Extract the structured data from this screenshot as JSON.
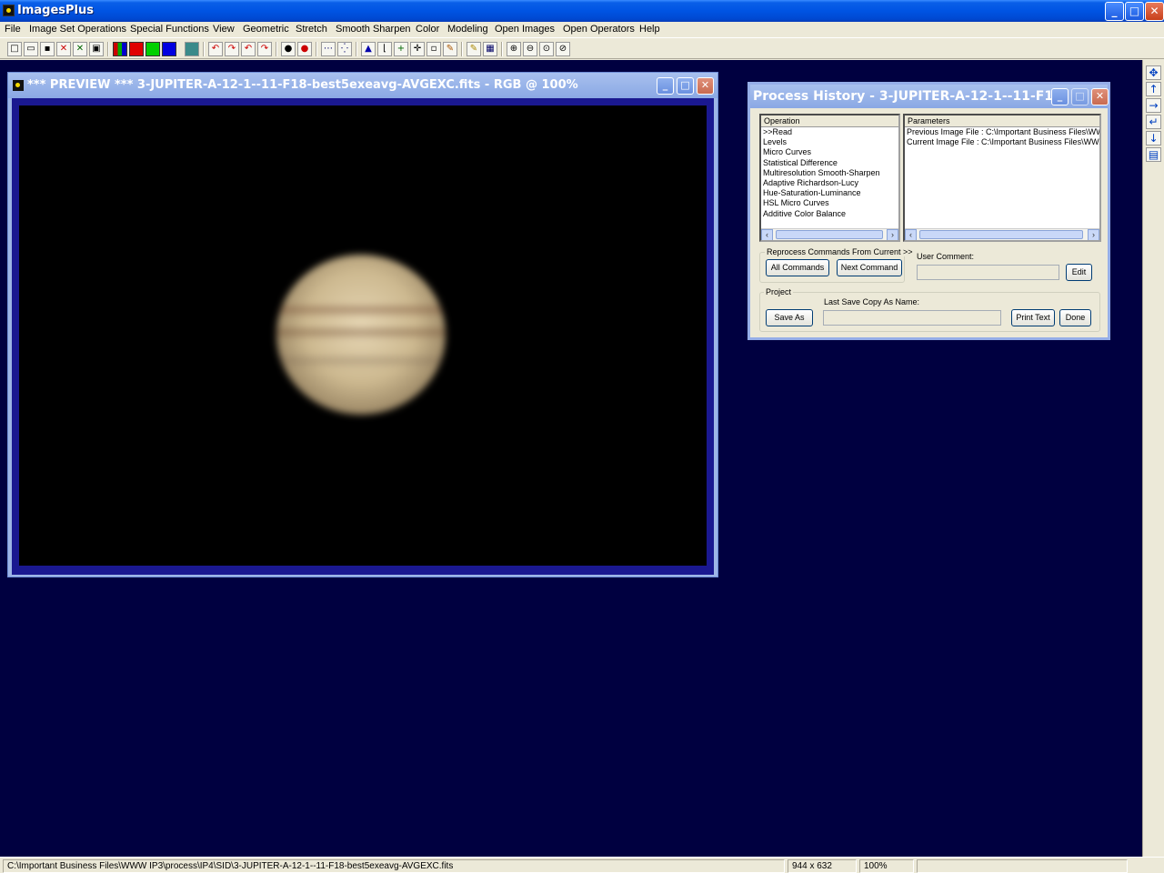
{
  "app": {
    "title": "ImagesPlus"
  },
  "menu": {
    "items": [
      "File",
      "Image Set Operations",
      "Special Functions",
      "View",
      "Geometric",
      "Stretch",
      "Smooth Sharpen",
      "Color",
      "Modeling",
      "Open Images",
      "Open Operators",
      "Help"
    ]
  },
  "toolbar": {
    "icons": [
      "new-file-icon",
      "open-folder-icon",
      "save-icon",
      "close-x-icon",
      "close-all-icon",
      "copy-window-icon",
      "rgb-channels-icon",
      "red-channel-icon",
      "green-channel-icon",
      "blue-channel-icon",
      "grid-icon",
      "undo-icon",
      "redo-icon",
      "undo-all-icon",
      "redo-all-icon",
      "circle-select-icon",
      "ellipse-select-icon",
      "dotted-line-icon",
      "point-select-icon",
      "histogram-icon",
      "curve-icon",
      "crosshair-icon",
      "move-icon",
      "frame-icon",
      "color-picker-icon",
      "pencil-icon",
      "mosaic-icon",
      "zoom-in-icon",
      "zoom-out-icon",
      "zoom-fit-icon",
      "zoom-actual-icon"
    ]
  },
  "preview": {
    "title": "*** PREVIEW *** 3-JUPITER-A-12-1--11-F18-best5exeavg-AVGEXC.fits - RGB @  100%"
  },
  "history": {
    "title": "Process History - 3-JUPITER-A-12-1--11-F1...",
    "operation_header": "Operation",
    "operations": [
      ">>Read",
      "Levels",
      "Micro Curves",
      "Statistical Difference",
      "Multiresolution Smooth-Sharpen",
      "Adaptive Richardson-Lucy",
      "Hue-Saturation-Luminance",
      "HSL Micro Curves",
      "Additive Color Balance"
    ],
    "parameters_header": "Parameters",
    "parameters": [
      "Previous Image File : C:\\Important Business Files\\WW...",
      "Current Image File : C:\\Important Business Files\\WW..."
    ],
    "reprocess_label": "Reprocess Commands From Current >>",
    "all_commands": "All Commands",
    "next_command": "Next Command",
    "user_comment_label": "User Comment:",
    "user_comment_value": "",
    "edit_button": "Edit",
    "project_label": "Project",
    "last_save_label": "Last Save Copy As Name:",
    "last_save_value": "",
    "save_as": "Save As",
    "print_text": "Print Text",
    "done": "Done"
  },
  "status": {
    "path": "C:\\Important Business Files\\WWW IP3\\process\\IP4\\SID\\3-JUPITER-A-12-1--11-F18-best5exeavg-AVGEXC.fits",
    "dimensions": "944 x 632",
    "zoom": "100%"
  },
  "window_controls": {
    "minimize": "_",
    "maximize": "□",
    "close": "✕"
  },
  "colors": {
    "workspace": "#000040",
    "image_frame": "#1a1890",
    "title_active": "#0054e3",
    "title_inactive": "#8aa8e4"
  }
}
